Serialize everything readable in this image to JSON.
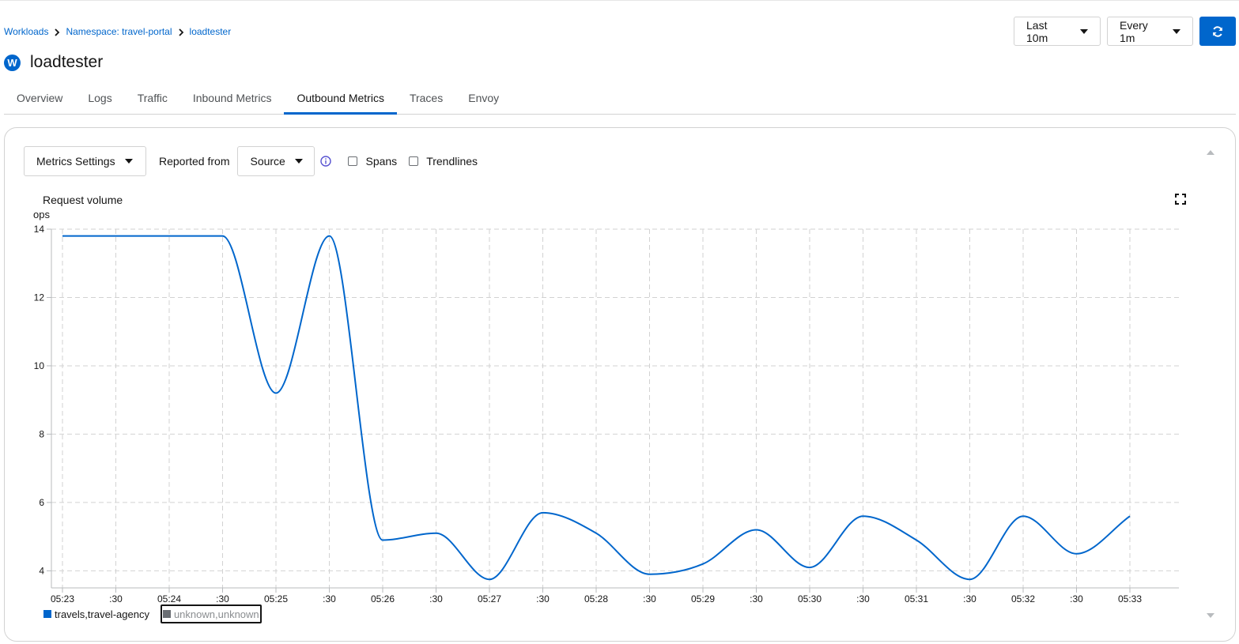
{
  "breadcrumb": {
    "items": [
      "Workloads",
      "Namespace: travel-portal",
      "loadtester"
    ]
  },
  "header": {
    "badge": "W",
    "title": "loadtester"
  },
  "controls": {
    "time_range": "Last 10m",
    "refresh_interval": "Every 1m",
    "refresh_icon": "sync-icon"
  },
  "tabs": [
    {
      "label": "Overview",
      "active": false
    },
    {
      "label": "Logs",
      "active": false
    },
    {
      "label": "Traffic",
      "active": false
    },
    {
      "label": "Inbound Metrics",
      "active": false
    },
    {
      "label": "Outbound Metrics",
      "active": true
    },
    {
      "label": "Traces",
      "active": false
    },
    {
      "label": "Envoy",
      "active": false
    }
  ],
  "toolbar": {
    "metrics_settings": "Metrics Settings",
    "reported_from_label": "Reported from",
    "reported_from_value": "Source",
    "spans_label": "Spans",
    "spans_checked": false,
    "trendlines_label": "Trendlines",
    "trendlines_checked": false
  },
  "colors": {
    "accent": "#0066cc",
    "series_primary": "#0066cc",
    "series_secondary": "#6a6e73"
  },
  "chart_data": {
    "type": "line",
    "title": "Request volume",
    "ylabel": "ops",
    "xlabel": "",
    "ylim": [
      3.5,
      14
    ],
    "yticks": [
      4,
      6,
      8,
      10,
      12,
      14
    ],
    "xtick_labels": [
      "05:23",
      ":30",
      "05:24",
      ":30",
      "05:25",
      ":30",
      "05:26",
      ":30",
      "05:27",
      ":30",
      "05:28",
      ":30",
      "05:29",
      ":30",
      "05:30",
      ":30",
      "05:31",
      ":30",
      "05:32",
      ":30",
      "05:33"
    ],
    "grid": true,
    "series": [
      {
        "name": "travels,travel-agency",
        "color": "#0066cc",
        "values": [
          13.8,
          13.8,
          13.8,
          13.8,
          9.2,
          13.8,
          4.9,
          5.1,
          3.75,
          5.7,
          5.1,
          3.9,
          4.2,
          5.2,
          4.1,
          5.6,
          4.9,
          3.75,
          5.6,
          4.5,
          5.6
        ]
      },
      {
        "name": "unknown,unknown",
        "color": "#6a6e73",
        "values": []
      }
    ]
  }
}
